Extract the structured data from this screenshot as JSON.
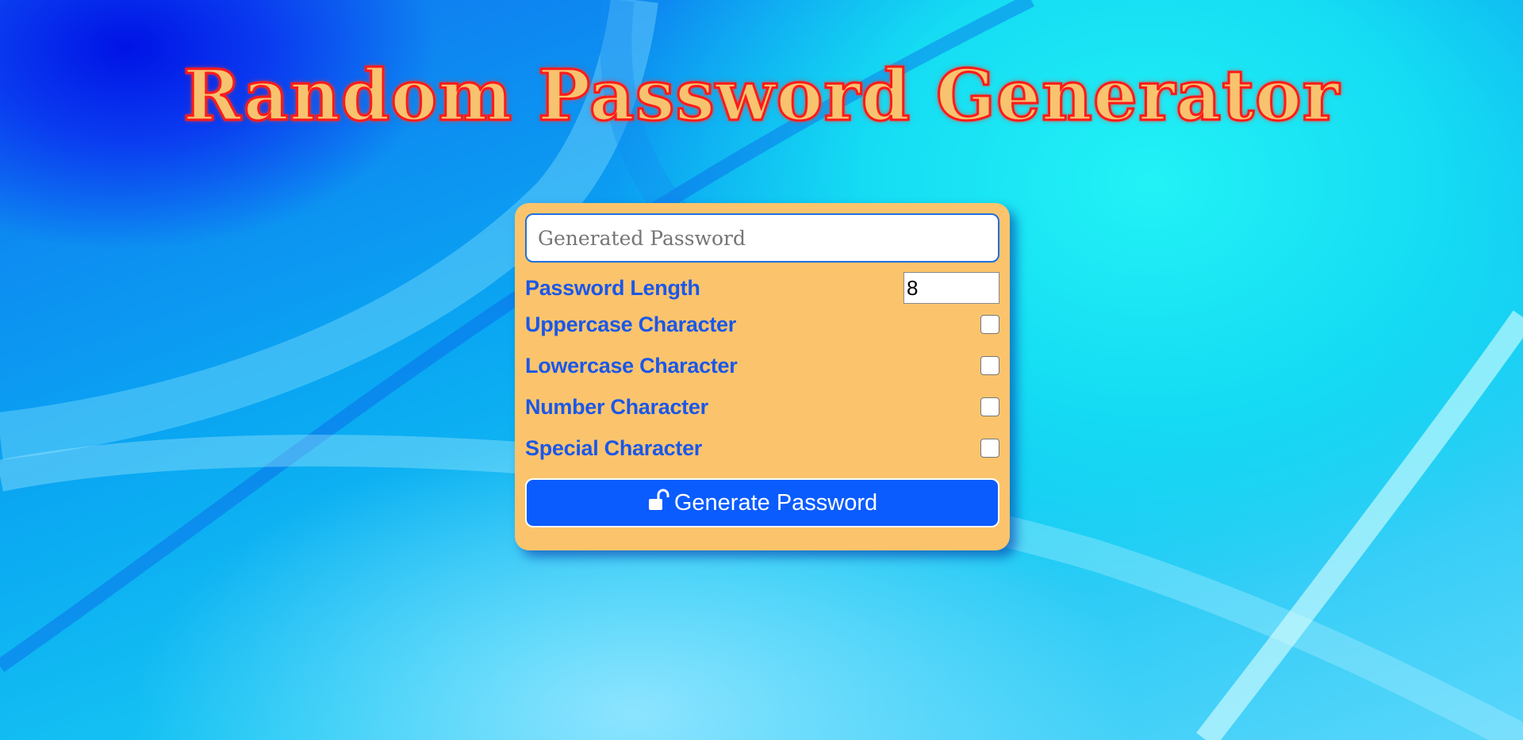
{
  "page": {
    "title": "Random Password Generator"
  },
  "output": {
    "placeholder": "Generated Password",
    "value": ""
  },
  "options": {
    "length_label": "Password Length",
    "length_value": "8",
    "uppercase_label": "Uppercase Character",
    "uppercase_checked": false,
    "lowercase_label": "Lowercase Character",
    "lowercase_checked": false,
    "number_label": "Number Character",
    "number_checked": false,
    "special_label": "Special Character",
    "special_checked": false
  },
  "button": {
    "icon": "unlock-icon",
    "label": "Generate Password"
  },
  "colors": {
    "title_fill": "#f7c36e",
    "title_stroke": "#ff1a1a",
    "card_background": "#fbc46c",
    "label_text": "#1b57e8",
    "button_background": "#0a5cff"
  }
}
